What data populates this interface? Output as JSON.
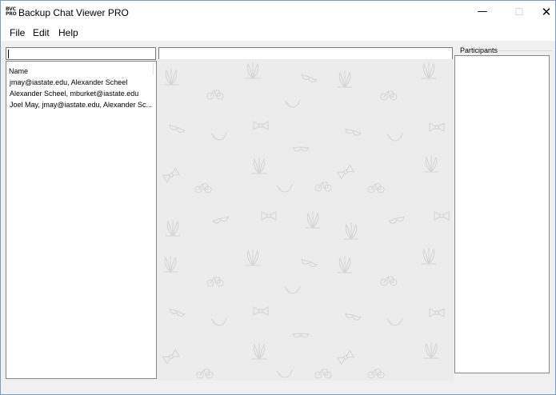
{
  "window": {
    "app_icon_top": "BVC",
    "app_icon_bottom": "PRO",
    "title": "Backup Chat Viewer PRO",
    "minimize_glyph": "—",
    "maximize_glyph": "☐",
    "close_glyph": "✕"
  },
  "menu": {
    "items": [
      {
        "label": "File"
      },
      {
        "label": "Edit"
      },
      {
        "label": "Help"
      }
    ]
  },
  "search": {
    "value": "",
    "message_filter_value": ""
  },
  "conversations": {
    "header": "Name",
    "rows": [
      {
        "name": "jmay@iastate.edu, Alexander Scheel"
      },
      {
        "name": "Alexander Scheel, mburket@iastate.edu"
      },
      {
        "name": "Joel May, jmay@iastate.edu, Alexander Sc..."
      }
    ]
  },
  "participants": {
    "label": "Participants"
  },
  "colors": {
    "chat_background": "#ececec",
    "pattern_stroke": "#d9d9d9"
  }
}
